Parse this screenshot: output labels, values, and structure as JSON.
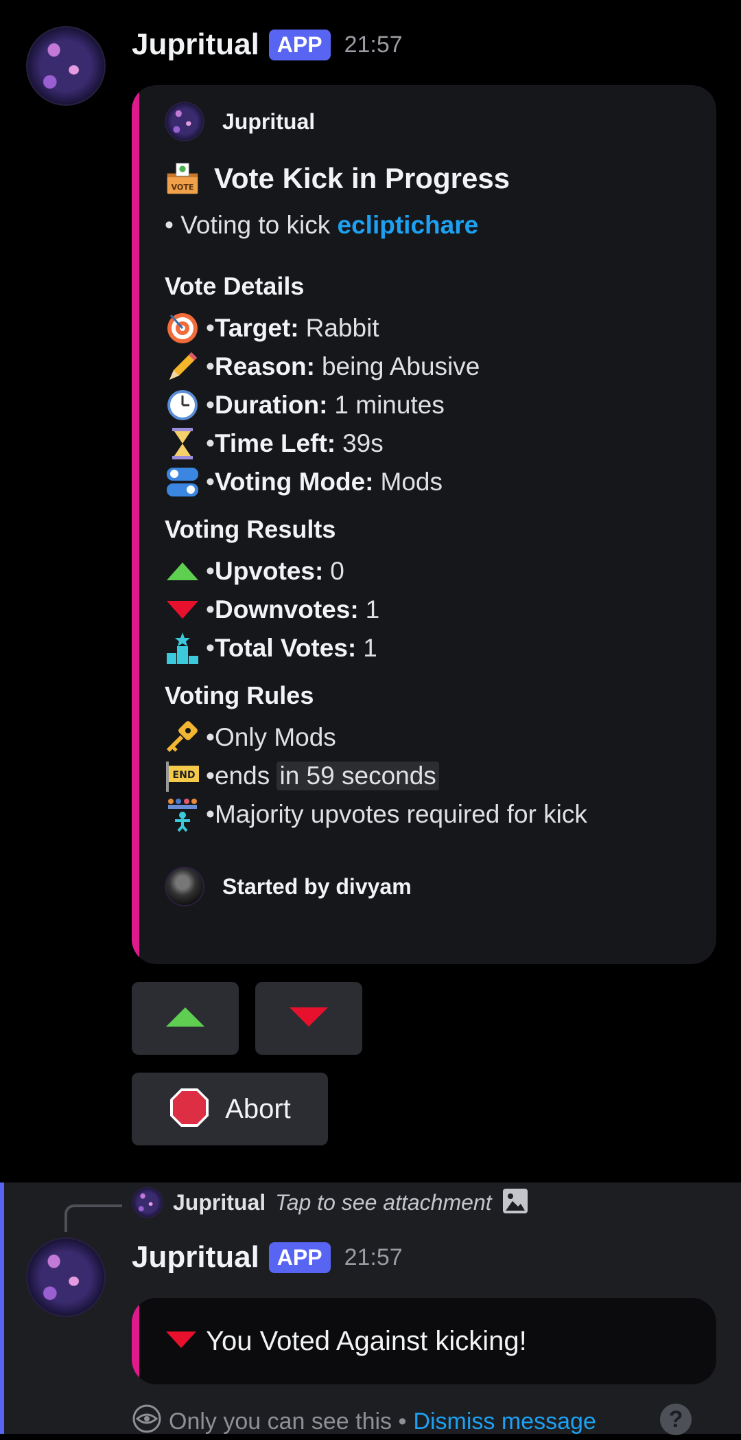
{
  "message1": {
    "author": "Jupritual",
    "badge": "APP",
    "time": "21:57",
    "embed": {
      "author_name": "Jupritual",
      "title": "Vote Kick in Progress",
      "voting_prefix": "• Voting to kick",
      "voting_target": "ecliptichare",
      "vote_details_title": "Vote Details",
      "details": [
        {
          "icon": "target-icon",
          "label": "Target:",
          "value": "Rabbit"
        },
        {
          "icon": "pencil-icon",
          "label": "Reason:",
          "value": "being Abusive"
        },
        {
          "icon": "clock-icon",
          "label": "Duration:",
          "value": "1 minutes"
        },
        {
          "icon": "hourglass-icon",
          "label": "Time Left:",
          "value": "39s"
        },
        {
          "icon": "toggle-icon",
          "label": "Voting Mode:",
          "value": "Mods"
        }
      ],
      "results_title": "Voting Results",
      "results": [
        {
          "icon": "up-triangle-icon",
          "label": "Upvotes:",
          "value": "0"
        },
        {
          "icon": "down-triangle-icon",
          "label": "Downvotes:",
          "value": "1"
        },
        {
          "icon": "podium-icon",
          "label": "Total Votes:",
          "value": "1"
        }
      ],
      "rules_title": "Voting Rules",
      "rules": [
        {
          "icon": "key-icon",
          "text": "Only Mods"
        },
        {
          "icon": "end-flag-icon",
          "prefix": "ends",
          "highlight": "in 59 seconds"
        },
        {
          "icon": "people-icon",
          "text": "Majority upvotes required for kick"
        }
      ],
      "footer": "Started by divyam"
    },
    "buttons": {
      "upvote_icon": "up-triangle-icon",
      "downvote_icon": "down-triangle-icon",
      "abort_label": "Abort"
    }
  },
  "message2": {
    "reply_author": "Jupritual",
    "reply_text": "Tap to see attachment",
    "author": "Jupritual",
    "badge": "APP",
    "time": "21:57",
    "embed_text": "You Voted Against kicking!",
    "footer_note": "Only you can see this •",
    "dismiss": "Dismiss message",
    "help": "?"
  },
  "colors": {
    "accent": "#5865f2",
    "embed_border": "#e01a8c",
    "link": "#1da1f2",
    "up": "#5fcf52",
    "down": "#e8112d"
  }
}
